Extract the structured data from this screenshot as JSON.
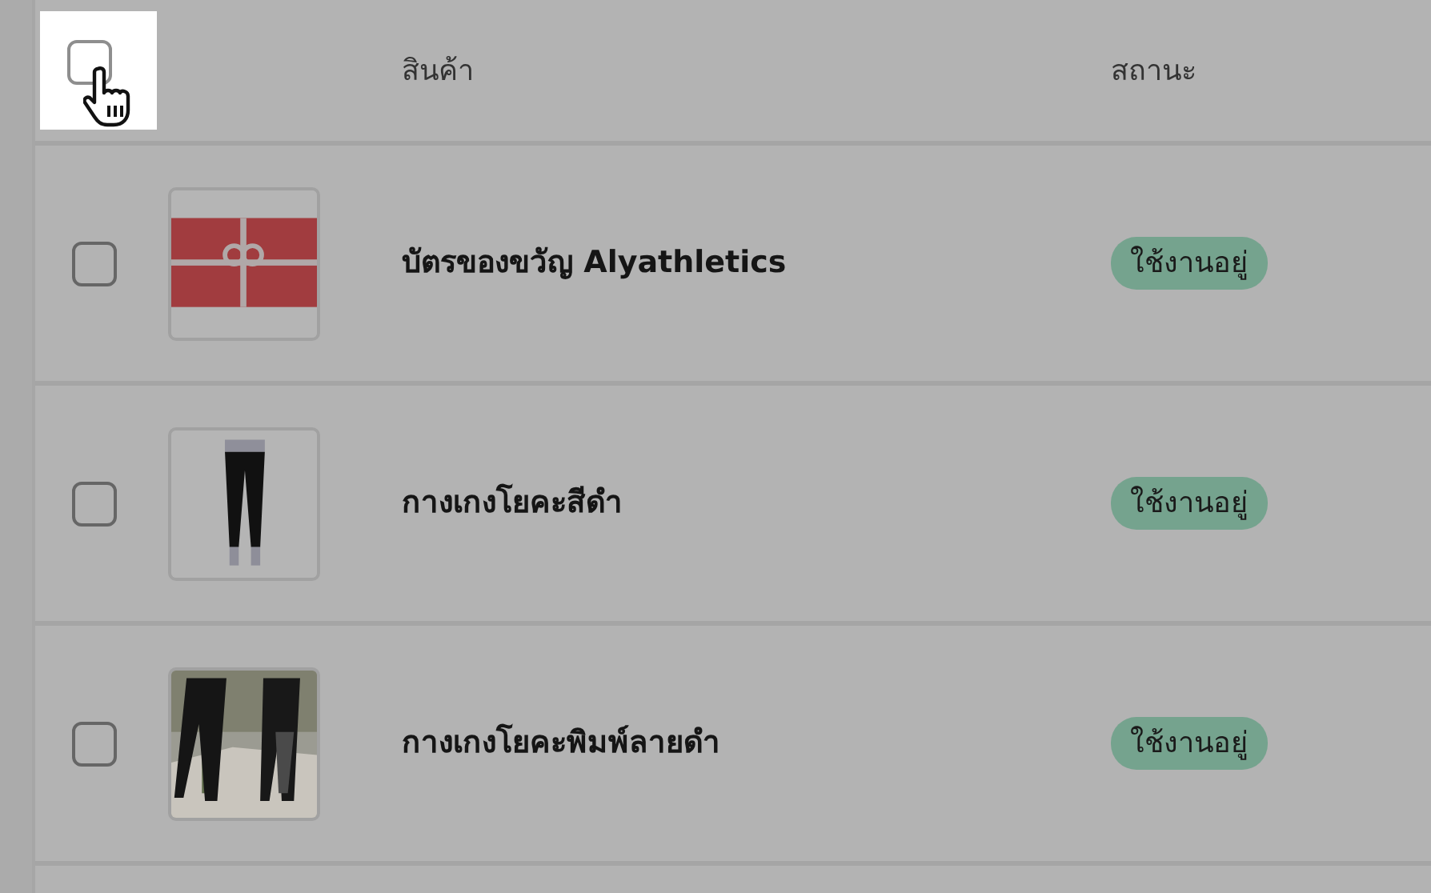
{
  "table": {
    "select_all": {
      "checked": false,
      "highlighted": true
    },
    "columns": [
      {
        "label": "สินค้า"
      },
      {
        "label": "สถานะ"
      }
    ],
    "rows": [
      {
        "checked": false,
        "name": "บัตรของขวัญ Alyathletics",
        "status": "ใช้งานอยู่"
      },
      {
        "checked": false,
        "name": "กางเกงโยคะสีดำ",
        "status": "ใช้งานอยู่"
      },
      {
        "checked": false,
        "name": "กางเกงโยคะพิมพ์ลายดำ",
        "status": "ใช้งานอยู่"
      }
    ]
  }
}
